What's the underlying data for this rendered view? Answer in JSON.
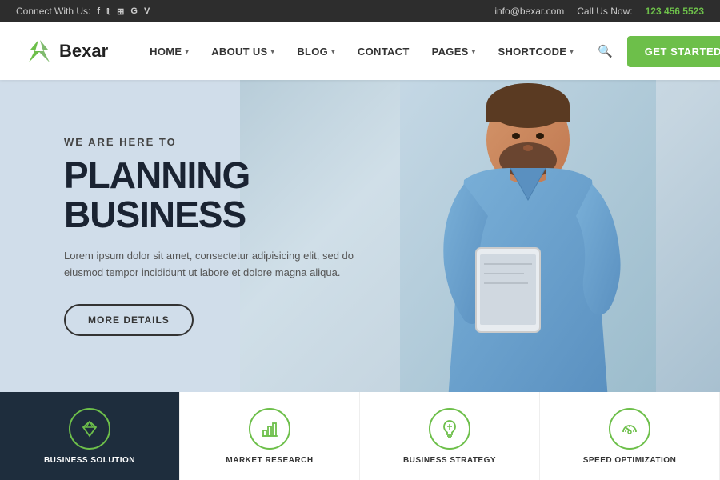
{
  "topbar": {
    "connect_label": "Connect With Us:",
    "social_icons": [
      "f",
      "t",
      "rss",
      "G",
      "V"
    ],
    "email": "info@bexar.com",
    "call_label": "Call Us Now:",
    "phone": "123 456 5523"
  },
  "header": {
    "logo_text": "Bexar",
    "nav_items": [
      {
        "label": "HOME",
        "has_arrow": true
      },
      {
        "label": "ABOUT US",
        "has_arrow": true
      },
      {
        "label": "BLOG",
        "has_arrow": true
      },
      {
        "label": "CONTACT",
        "has_arrow": false
      },
      {
        "label": "PAGES",
        "has_arrow": true
      },
      {
        "label": "SHORTCODE",
        "has_arrow": true
      }
    ],
    "cta_label": "GET STARTED"
  },
  "hero": {
    "subtitle": "WE ARE HERE TO",
    "title": "PLANNING BUSINESS",
    "description": "Lorem ipsum dolor sit amet, consectetur adipisicing elit, sed do eiusmod tempor incididunt ut labore et dolore magna aliqua.",
    "button_label": "MORE DETAILS"
  },
  "cards": [
    {
      "label": "BUSINESS SOLUTION",
      "icon": "diamond",
      "dark": true
    },
    {
      "label": "MARKET RESEARCH",
      "icon": "bar",
      "dark": false
    },
    {
      "label": "BUSINESS STRATEGY",
      "icon": "bulb",
      "dark": false
    },
    {
      "label": "SPEED OPTIMIZATION",
      "icon": "gauge",
      "dark": false
    }
  ],
  "colors": {
    "green": "#6dbf4a",
    "dark_navy": "#1e2d3d",
    "text_dark": "#1a2332"
  }
}
